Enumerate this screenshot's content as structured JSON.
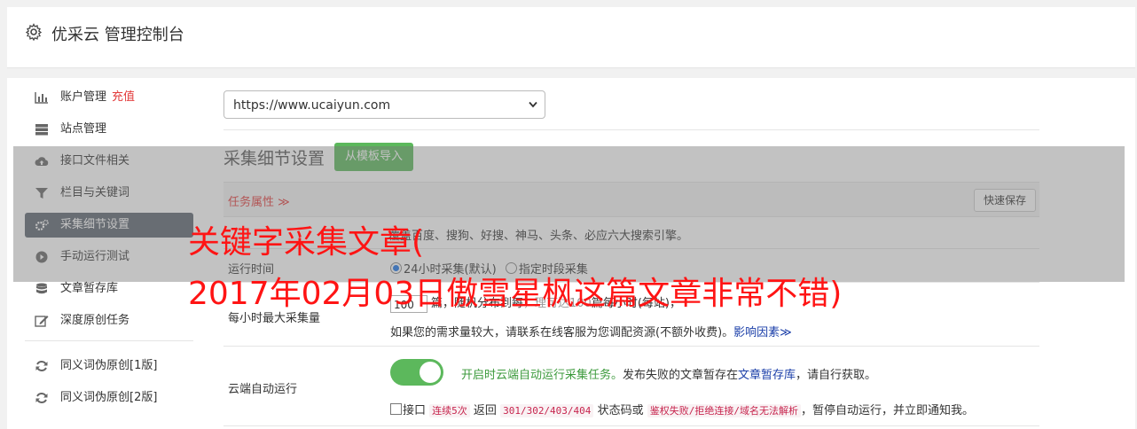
{
  "header": {
    "title": "优采云 管理控制台",
    "icon": "gear-icon"
  },
  "sidebar": {
    "items": [
      {
        "label": "账户管理",
        "tag": "充值",
        "icon": "bar-chart-icon"
      },
      {
        "label": "站点管理",
        "icon": "server-icon"
      },
      {
        "label": "接口文件相关",
        "icon": "cloud-upload-icon"
      },
      {
        "label": "栏目与关键词",
        "icon": "filter-icon"
      },
      {
        "label": "采集细节设置",
        "icon": "gears-icon",
        "active": true
      },
      {
        "label": "手动运行测试",
        "icon": "play-circle-icon"
      },
      {
        "label": "文章暂存库",
        "icon": "database-icon"
      },
      {
        "label": "深度原创任务",
        "icon": "edit-icon"
      }
    ],
    "items2": [
      {
        "label": "同义词伪原创[1版]",
        "icon": "refresh-icon"
      },
      {
        "label": "同义词伪原创[2版]",
        "icon": "refresh-icon"
      }
    ]
  },
  "main": {
    "site_select": "https://www.ucaiyun.com",
    "section_title": "采集细节设置",
    "import_button": "从模板导入",
    "task_attr": "任务属性 ≫",
    "quick_save": "快速保存",
    "search_note": "覆盖百度、搜狗、好搜、神马、头条、必应六大搜索引擎。",
    "run_time_label": "运行时间",
    "radio_24h": "24小时采集(默认)",
    "radio_period": "指定时段采集",
    "max_per_hour_label": "每小时最大采集量",
    "max_value": "100",
    "max_note_a": "篇，随机分布到每",
    "max_note_b": "，理可达100",
    "max_note_c": "篇每小时(每站)，",
    "max_note_line2": "如果您的需求量较大，请联系在线客服为您调配资源(不额外收费)。",
    "influence_link": "影响因素≫",
    "cloud_run_label": "云端自动运行",
    "cloud_note_green": "开启时云端自动运行采集任务。",
    "cloud_note_a": "发布失败的文章暂存在",
    "cloud_note_link": "文章暂存库",
    "cloud_note_b": "，请自行获取。",
    "iface_a": "接口",
    "iface_code1": "连续5次",
    "iface_b": "返回",
    "iface_code2": "301/302/403/404",
    "iface_c": "状态码或",
    "iface_code3": "鉴权失败/拒绝连接/域名无法解析",
    "iface_d": "，暂停自动运行，并立即通知我。"
  },
  "watermark": {
    "line1": "关键字采集文章(",
    "line2": "2017年02月03日傲雪星枫这篇文章非常不错)"
  }
}
